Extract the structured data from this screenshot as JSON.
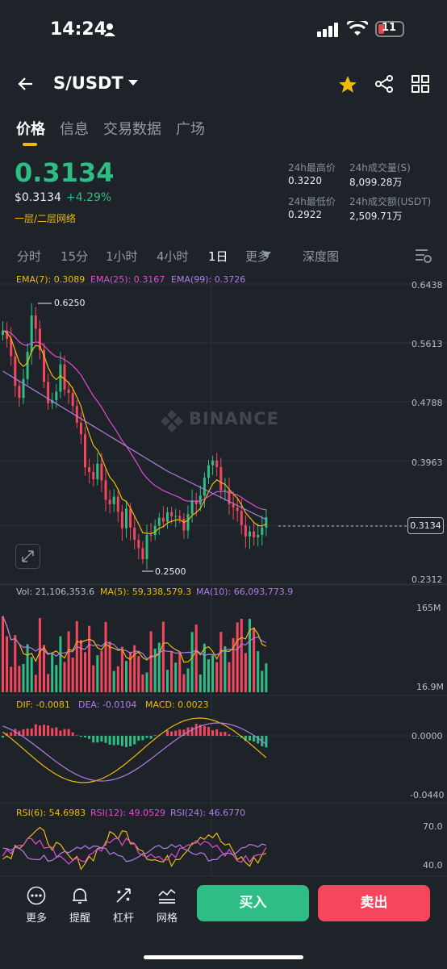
{
  "status_bar": {
    "time": "14:24",
    "battery": "11"
  },
  "header": {
    "pair": "S/USDT"
  },
  "tabs": [
    "价格",
    "信息",
    "交易数据",
    "广场"
  ],
  "price": {
    "last": "0.3134",
    "usd": "$0.3134",
    "change": "+4.29%",
    "network": "一层/二层网络"
  },
  "stats": {
    "high_label": "24h最高价",
    "high": "0.3220",
    "low_label": "24h最低价",
    "low": "0.2922",
    "vol_label": "24h成交量(S)",
    "vol": "8,099.28万",
    "amt_label": "24h成交额(USDT)",
    "amt": "2,509.71万"
  },
  "intervals": [
    "分时",
    "15分",
    "1小时",
    "4小时",
    "1日",
    "更多",
    "深度图"
  ],
  "indicators": {
    "ema7": "EMA(7): 0.3089",
    "ema25": "EMA(25): 0.3167",
    "ema99": "EMA(99): 0.3726",
    "vol": "Vol: 21,106,353.6",
    "ma5": "MA(5): 59,338,579.3",
    "ma10": "MA(10): 66,093,773.9",
    "dif": "DIF: -0.0081",
    "dea": "DEA: -0.0104",
    "macd": "MACD: 0.0023",
    "rsi6": "RSI(6): 54.6983",
    "rsi12": "RSI(12): 49.0529",
    "rsi24": "RSI(24): 46.6770"
  },
  "price_axis": [
    "0.6438",
    "0.5613",
    "0.4788",
    "0.3963",
    "0.2312"
  ],
  "current_price_tag": "0.3134",
  "high_marker": "0.6250",
  "low_marker": "0.2500",
  "watermark": "BINANCE",
  "vol_axis": [
    "165M",
    "16.9M"
  ],
  "macd_axis": [
    "0.0000",
    "-0.0440"
  ],
  "rsi_axis": [
    "70.0",
    "40.0"
  ],
  "bottom_bar": {
    "more": "更多",
    "alert": "提醒",
    "leverage": "杠杆",
    "grid": "网格",
    "buy": "买入",
    "sell": "卖出"
  },
  "colors": {
    "up": "#2ebd85",
    "down": "#f6465d",
    "accent": "#f0b90b",
    "ema7": "#f0b90b",
    "ema25": "#e54bd3",
    "ema99": "#b27ce6"
  }
}
